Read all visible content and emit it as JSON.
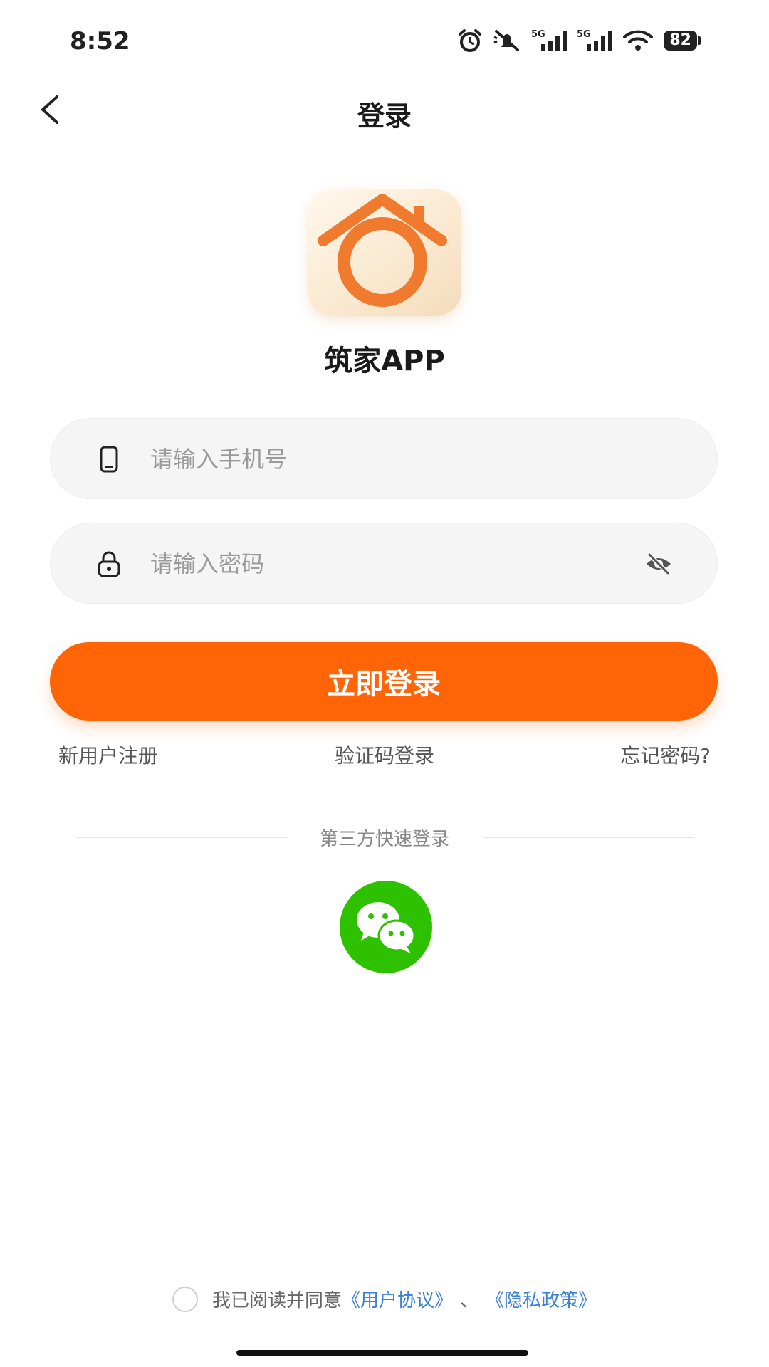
{
  "status_bar": {
    "time": "8:52",
    "battery": "82",
    "network_1": "5G",
    "network_2": "5G",
    "icons": [
      "alarm-icon",
      "mute-icon",
      "signal-icon",
      "signal-icon",
      "wifi-icon",
      "battery-icon"
    ]
  },
  "nav": {
    "title": "登录",
    "back_icon": "chevron-left-icon"
  },
  "brand": {
    "app_name": "筑家APP",
    "logo_icon": "house-icon",
    "accent_color": "#ff6407"
  },
  "form": {
    "phone_placeholder": "请输入手机号",
    "password_placeholder": "请输入密码",
    "phone_icon": "phone-icon",
    "lock_icon": "lock-icon",
    "eye_icon": "eye-off-icon",
    "login_label": "立即登录"
  },
  "links": {
    "register": "新用户注册",
    "sms_login": "验证码登录",
    "forgot": "忘记密码?"
  },
  "third_party": {
    "label": "第三方快速登录",
    "wechat_icon": "wechat-icon"
  },
  "agreement": {
    "prefix": "我已阅读并同意",
    "user_agreement": "《用户协议》",
    "separator": "、",
    "privacy_policy": "《隐私政策》",
    "link_color": "#3b7fd6"
  }
}
